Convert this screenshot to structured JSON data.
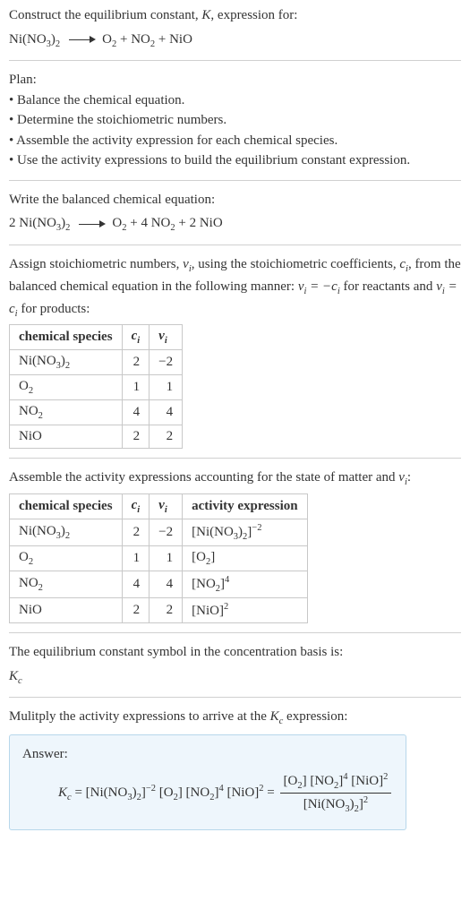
{
  "header": {
    "title_pre": "Construct the equilibrium constant, ",
    "title_K": "K",
    "title_post": ", expression for:"
  },
  "given_eq": {
    "lhs": "Ni(NO<sub>3</sub>)<sub>2</sub>",
    "rhs": "O<sub>2</sub> + NO<sub>2</sub> + NiO"
  },
  "plan": {
    "label": "Plan:",
    "items": [
      "Balance the chemical equation.",
      "Determine the stoichiometric numbers.",
      "Assemble the activity expression for each chemical species.",
      "Use the activity expressions to build the equilibrium constant expression."
    ]
  },
  "balanced": {
    "intro": "Write the balanced chemical equation:",
    "lhs": "2 Ni(NO<sub>3</sub>)<sub>2</sub>",
    "rhs": "O<sub>2</sub> + 4 NO<sub>2</sub> + 2 NiO"
  },
  "stoich_text": {
    "pre": "Assign stoichiometric numbers, ",
    "nu": "ν<sub><i>i</i></sub>",
    "mid1": ", using the stoichiometric coefficients, ",
    "ci": "c<sub><i>i</i></sub>",
    "mid2": ", from the balanced chemical equation in the following manner: ",
    "rel1": "ν<sub><i>i</i></sub> = −c<sub><i>i</i></sub>",
    "mid3": " for reactants and ",
    "rel2": "ν<sub><i>i</i></sub> = c<sub><i>i</i></sub>",
    "post": " for products:"
  },
  "table1": {
    "head": [
      "chemical species",
      "<i>c<sub>i</sub></i>",
      "<i>ν<sub>i</sub></i>"
    ],
    "rows": [
      [
        "Ni(NO<sub>3</sub>)<sub>2</sub>",
        "2",
        "−2"
      ],
      [
        "O<sub>2</sub>",
        "1",
        "1"
      ],
      [
        "NO<sub>2</sub>",
        "4",
        "4"
      ],
      [
        "NiO",
        "2",
        "2"
      ]
    ]
  },
  "activity_text": {
    "pre": "Assemble the activity expressions accounting for the state of matter and ",
    "nu": "ν<sub><i>i</i></sub>",
    "post": ":"
  },
  "table2": {
    "head": [
      "chemical species",
      "<i>c<sub>i</sub></i>",
      "<i>ν<sub>i</sub></i>",
      "activity expression"
    ],
    "rows": [
      [
        "Ni(NO<sub>3</sub>)<sub>2</sub>",
        "2",
        "−2",
        "[Ni(NO<sub>3</sub>)<sub>2</sub>]<sup>−2</sup>"
      ],
      [
        "O<sub>2</sub>",
        "1",
        "1",
        "[O<sub>2</sub>]"
      ],
      [
        "NO<sub>2</sub>",
        "4",
        "4",
        "[NO<sub>2</sub>]<sup>4</sup>"
      ],
      [
        "NiO",
        "2",
        "2",
        "[NiO]<sup>2</sup>"
      ]
    ]
  },
  "kc_intro": "The equilibrium constant symbol in the concentration basis is:",
  "kc_symbol": "K<sub>c</sub>",
  "mult_text_pre": "Mulitply the activity expressions to arrive at the ",
  "mult_text_post": " expression:",
  "answer": {
    "label": "Answer:",
    "lhs": "<span class=\"kc\">K<sub>c</sub></span> = [Ni(NO<sub>3</sub>)<sub>2</sub>]<sup>−2</sup> [O<sub>2</sub>] [NO<sub>2</sub>]<sup>4</sup> [NiO]<sup>2</sup> = ",
    "num": "[O<sub>2</sub>] [NO<sub>2</sub>]<sup>4</sup> [NiO]<sup>2</sup>",
    "den": "[Ni(NO<sub>3</sub>)<sub>2</sub>]<sup>2</sup>"
  }
}
